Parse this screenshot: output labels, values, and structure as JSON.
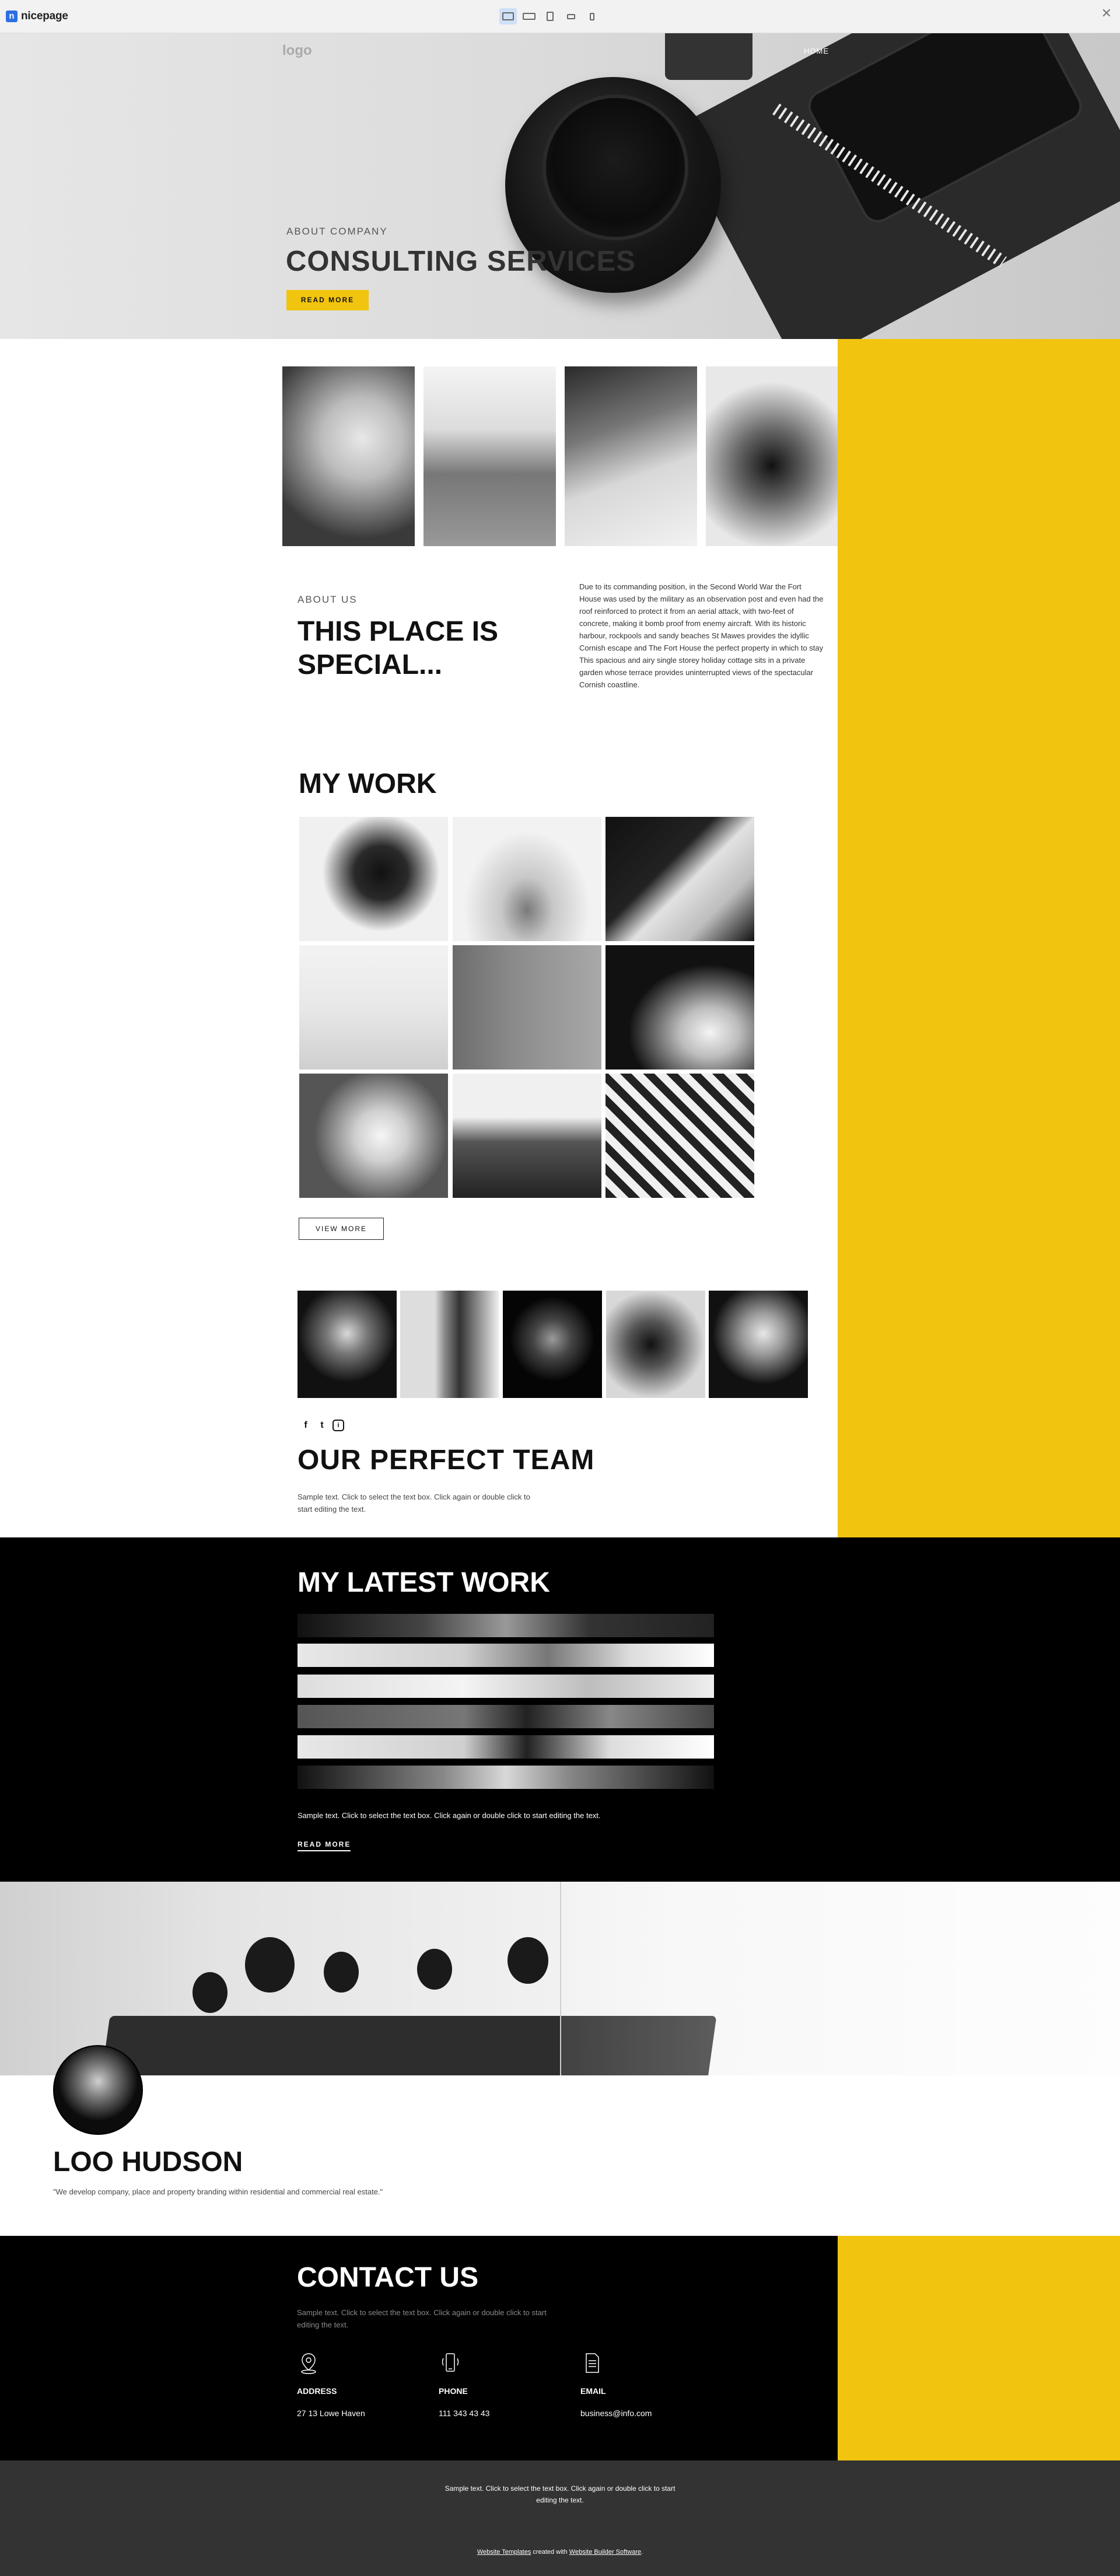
{
  "editor": {
    "brand_badge": "n",
    "brand_name": "nicepage",
    "devices": [
      "desktop-icon",
      "laptop-icon",
      "tablet-icon",
      "phone-landscape-icon",
      "phone-portrait-icon"
    ],
    "active_device": "desktop",
    "close": "✕"
  },
  "hero": {
    "logo": "logo",
    "nav_home": "HOME",
    "subtitle": "ABOUT COMPANY",
    "title": "CONSULTING SERVICES",
    "button": "READ MORE"
  },
  "about": {
    "label": "ABOUT US",
    "title": "THIS PLACE IS SPECIAL...",
    "text": "Due to its commanding position, in the Second World War the Fort House was used by the military as an observation post and even had the roof reinforced to protect it from an aerial attack, with two-feet of concrete, making it bomb proof from enemy aircraft. With its historic harbour, rockpools and sandy beaches St Mawes provides the idyllic Cornish escape and The Fort House the perfect property in which to stay This spacious and airy single storey holiday cottage sits in a private garden whose terrace provides uninterrupted views of the spectacular Cornish coastline."
  },
  "work": {
    "title": "MY WORK",
    "button": "VIEW MORE"
  },
  "team": {
    "social": [
      "f",
      "t",
      "i"
    ],
    "title": "OUR PERFECT TEAM",
    "text": "Sample text. Click to select the text box. Click again or double click to start editing the text."
  },
  "latest": {
    "title": "MY LATEST WORK",
    "text": "Sample text. Click to select the text box. Click again or double click to start editing the text.",
    "button": "READ MORE"
  },
  "profile": {
    "name": "LOO HUDSON",
    "quote": "\"We develop company, place and property branding within residential and commercial real estate.\""
  },
  "contact": {
    "title": "CONTACT US",
    "text": "Sample text. Click to select the text box. Click again or double click to start editing the text.",
    "items": [
      {
        "label": "ADDRESS",
        "value": "27 13 Lowe Haven",
        "icon": "map-pin-icon"
      },
      {
        "label": "PHONE",
        "value": "111 343 43 43",
        "icon": "phone-icon"
      },
      {
        "label": "EMAIL",
        "value": "business@info.com",
        "icon": "document-icon"
      }
    ]
  },
  "footer": {
    "text": "Sample text. Click to select the text box. Click again or double click to start editing the text.",
    "link1": "Website Templates",
    "middle": "created with",
    "link2": "Website Builder Software",
    "end": "."
  },
  "colors": {
    "accent_yellow": "#f1c40f",
    "dark": "#000000",
    "footer": "#333333",
    "editor_blue": "#2b6fe0"
  }
}
